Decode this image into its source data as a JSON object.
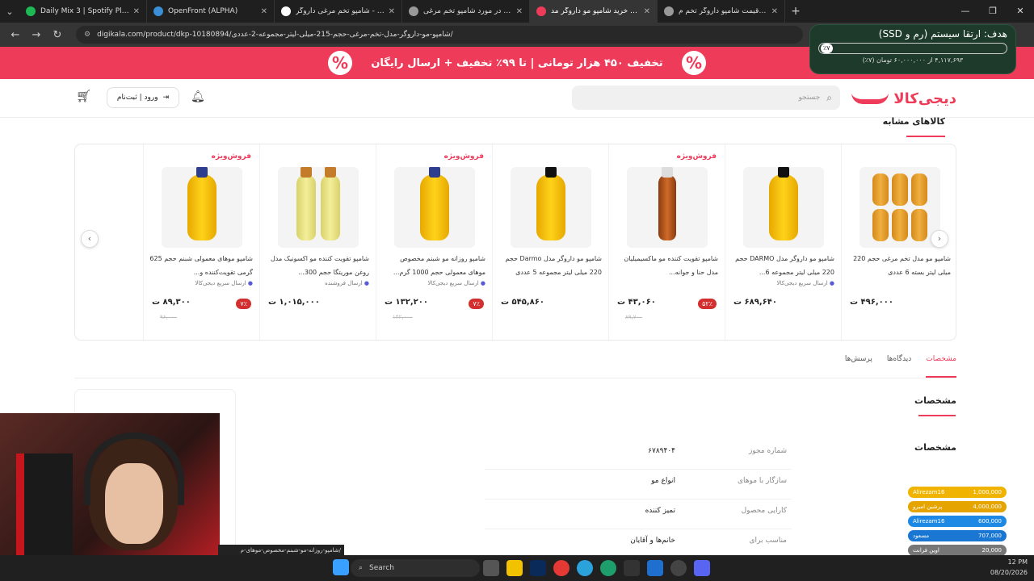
{
  "browser": {
    "tabs": [
      {
        "label": "Daily Mix 3 | Spotify Playlist",
        "favicon_color": "#1db954",
        "active": false
      },
      {
        "label": "OpenFront (ALPHA)",
        "favicon_color": "#3a8fd6",
        "active": false
      },
      {
        "label": "شامپو تخم مرغی داروگر - Search",
        "favicon_color": "#ffffff",
        "active": false
      },
      {
        "label": "نظراتون در مورد شامپو تخم مرغی",
        "favicon_color": "#999999",
        "active": false
      },
      {
        "label": "قیمت و خرید شامپو مو داروگر مد",
        "favicon_color": "#ef3b5a",
        "active": true
      },
      {
        "label": "خرید و قیمت شامپو داروگر تخم م",
        "favicon_color": "#999999",
        "active": false
      }
    ],
    "url": "digikala.com/product/dkp-10180894/شامپو-مو-داروگر-مدل-تخم-مرغی-حجم-215-میلی-لیتر-مجموعه-2-عددی/"
  },
  "promo": {
    "text": "تخفیف ۴۵۰ هزار تومانی | تا ۹۹٪ تخفیف + ارسال رایگان",
    "badge": "%",
    "color": "#ef3b5a"
  },
  "goal_widget": {
    "title": "هدف: ارتقا سیستم (رم و SSD)",
    "percent_label": "٪۷",
    "progress": 0.07,
    "subtitle": "۴,۱۱۷,۶۹۳ از ۶۰,۰۰۰,۰۰۰ تومان (۷٪)"
  },
  "header": {
    "logo_text": "دیجی‌کالا",
    "search_placeholder": "جستجو",
    "login_label": "ورود | ثبت‌نام"
  },
  "similar": {
    "title": "کالاهای مشابه",
    "special_label": "فروش‌ویژه",
    "products": [
      {
        "name": "شامپو مو مدل تخم مرغی حجم 220 میلی لیتر بسته 6 عددی",
        "ship": "",
        "price": "۴۹۶,۰۰۰",
        "discount": "",
        "old": "",
        "special": false,
        "img": "multi"
      },
      {
        "name": "شامپو مو داروگر مدل DARMO حجم 220 میلی لیتر مجموعه 6...",
        "ship": "ارسال سریع دیجی‌کالا",
        "price": "۶۸۹,۶۴۰",
        "discount": "",
        "old": "",
        "special": false,
        "img": "yellow"
      },
      {
        "name": "شامپو تقویت کننده مو ماکسیمیلیان مدل حنا و جوانه...",
        "ship": "",
        "price": "۴۳,۰۶۰",
        "discount": "۵۲٪",
        "old": "۸۹,۷۰۰",
        "special": true,
        "img": "amber"
      },
      {
        "name": "شامپو مو داروگر مدل Darmo حجم 220 میلی لیتر مجموعه 5 عددی",
        "ship": "",
        "price": "۵۴۵,۸۶۰",
        "discount": "",
        "old": "",
        "special": false,
        "img": "yellow"
      },
      {
        "name": "شامپو روزانه مو شبنم مخصوص موهای معمولی حجم 1000 گرم...",
        "ship": "ارسال سریع دیجی‌کالا",
        "price": "۱۳۲,۲۰۰",
        "discount": "۷٪",
        "old": "۱۴۲,۰۰۰",
        "special": true,
        "img": "blue"
      },
      {
        "name": "شامپو تقویت کننده مو اکسونیک مدل روغن موریتگا حجم 300...",
        "ship": "ارسال فروشنده",
        "price": "۱,۰۱۵,۰۰۰",
        "discount": "",
        "old": "",
        "special": false,
        "img": "pale"
      },
      {
        "name": "شامپو موهای معمولی شبنم حجم 625 گرمی تقویت‌کننده و...",
        "ship": "ارسال سریع دیجی‌کالا",
        "price": "۸۹,۳۰۰",
        "discount": "۷٪",
        "old": "۹۶,۰۰۰",
        "special": true,
        "img": "blue"
      }
    ]
  },
  "spec_tabs": [
    "مشخصات",
    "دیدگاه‌ها",
    "پرسش‌ها"
  ],
  "specs": {
    "title": "مشخصات",
    "subtitle": "مشخصات",
    "rows": [
      {
        "k": "شماره مجوز",
        "v": "۶۷۸۹۴۰۴"
      },
      {
        "k": "سازگار با موهای",
        "v": "انواع مو"
      },
      {
        "k": "کارایی محصول",
        "v": "تمیز کننده"
      },
      {
        "k": "مناسب برای",
        "v": "خانم‌ها و آقایان"
      }
    ]
  },
  "status_url": "/شامپو-روزانه-مو-شبنم-مخصوص-موهای-م",
  "donations": [
    {
      "name": "Alirezam16",
      "amount": "1,000,000",
      "color": "#f0b400"
    },
    {
      "name": "پرشین امیرو",
      "amount": "4,000,000",
      "color": "#e5a400"
    },
    {
      "name": "Alirezam16",
      "amount": "600,000",
      "color": "#1e88e5"
    },
    {
      "name": "مسعود",
      "amount": "707,000",
      "color": "#1976d2"
    },
    {
      "name": "اوین فرانت",
      "amount": "20,000",
      "color": "#777777"
    },
    {
      "name": "Amirmahdi_Rml",
      "amount": "70,000",
      "color": "#666666"
    }
  ],
  "taskbar": {
    "search_label": "Search",
    "time": "12 PM",
    "date": "08/20/2026"
  }
}
